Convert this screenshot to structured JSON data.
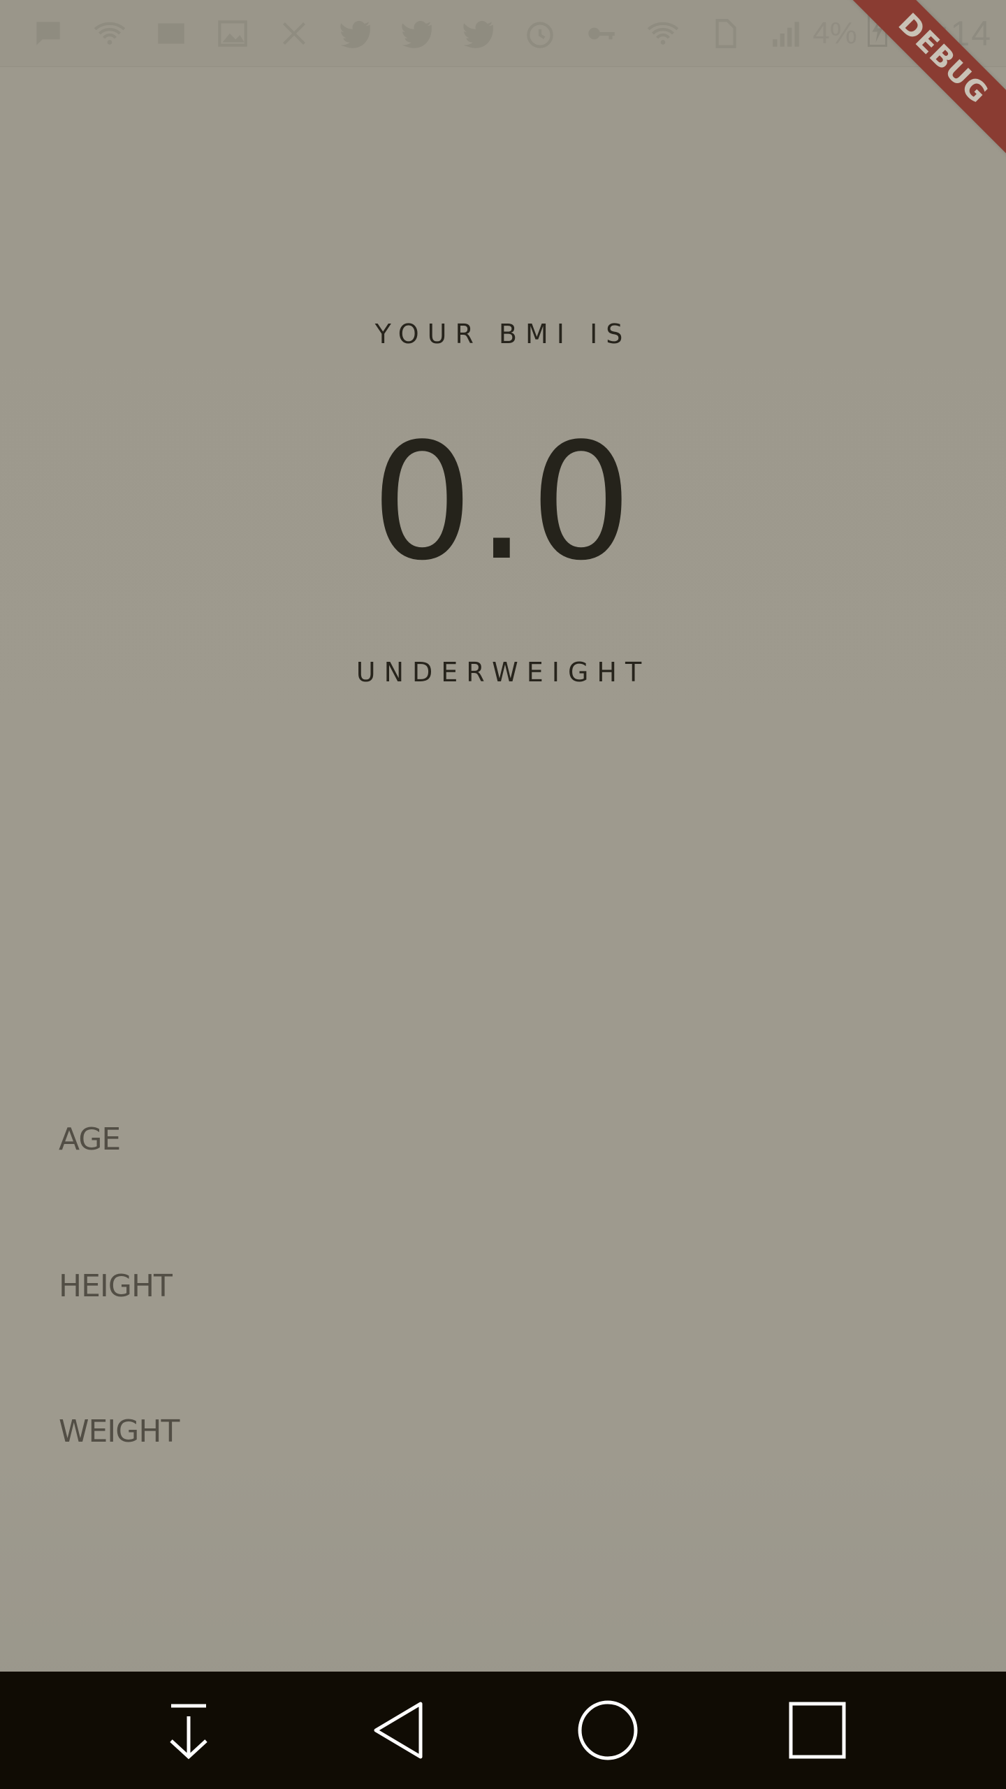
{
  "status_bar": {
    "icons": [
      "chat-icon",
      "wifi-icon",
      "mail-icon",
      "image-icon",
      "x-icon",
      "twitter-icon",
      "twitter-icon",
      "twitter-icon",
      "alarm-icon",
      "key-icon",
      "wifi-icon",
      "sim-icon",
      "signal-icon"
    ],
    "battery": "4%",
    "time": "10:14"
  },
  "debug_banner": "DEBUG",
  "result": {
    "caption": "YOUR BMI IS",
    "value": "0.0",
    "category": "UNDERWEIGHT"
  },
  "fields": {
    "age_label": "AGE",
    "height_label": "HEIGHT",
    "weight_label": "WEIGHT"
  },
  "nav": {
    "buttons": [
      "download-icon",
      "back-icon",
      "home-icon",
      "recents-icon"
    ]
  },
  "colors": {
    "background": "#9d998d",
    "text_dark": "#25231b",
    "label": "#524e45",
    "nav_bar": "#100c04",
    "debug_ribbon": "#8a3c32"
  }
}
